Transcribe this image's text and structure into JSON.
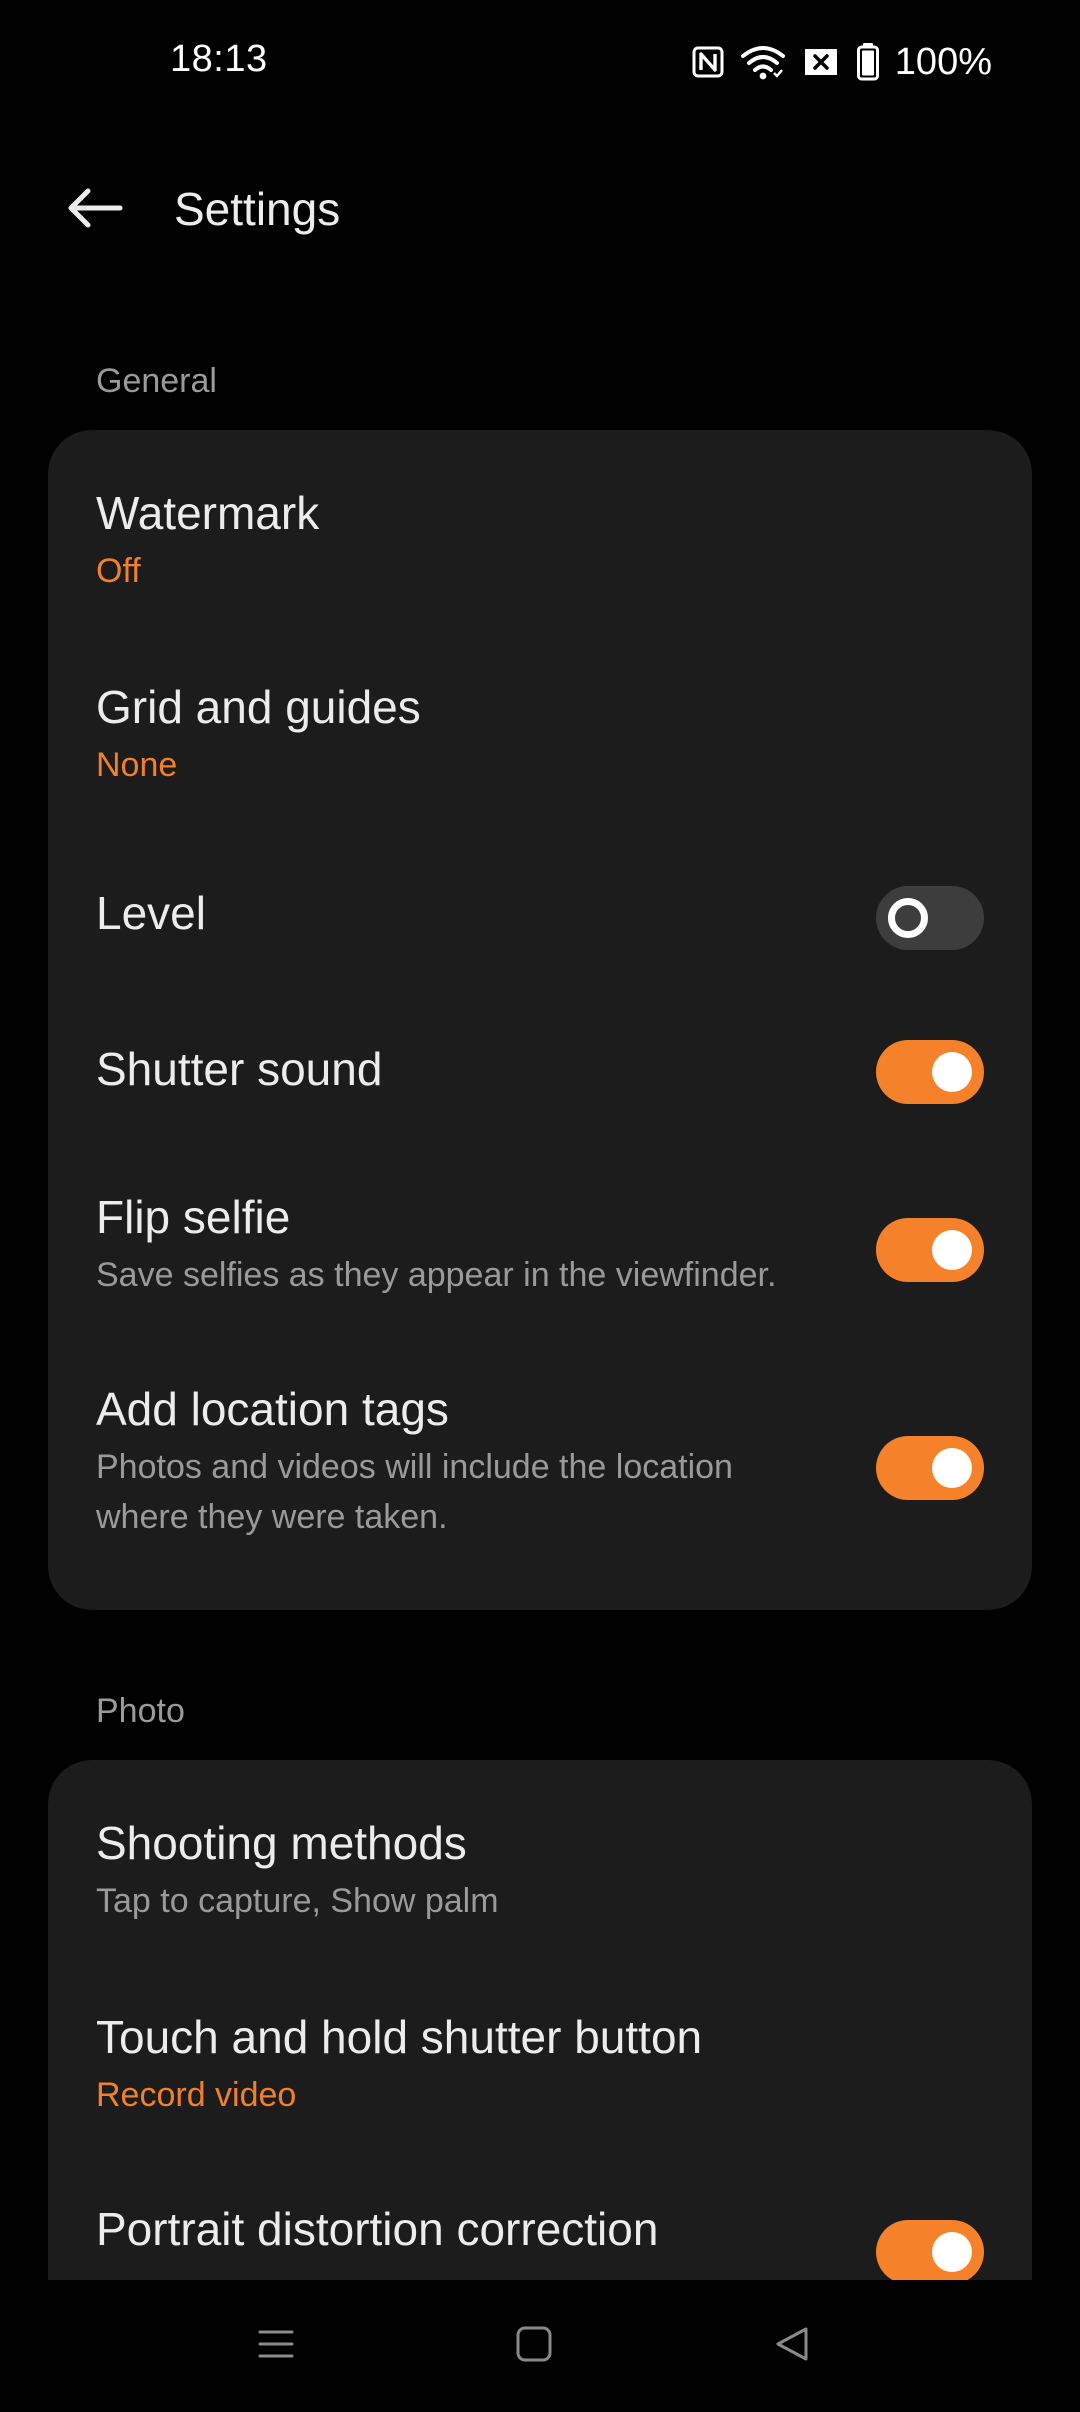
{
  "status_bar": {
    "time": "18:13",
    "battery": "100%",
    "icons": [
      "nfc-icon",
      "wifi-icon",
      "sim-off-icon",
      "battery-icon"
    ]
  },
  "header": {
    "title": "Settings",
    "back_icon": "arrow-left-icon"
  },
  "colors": {
    "accent": "#f5822a",
    "background": "#000000",
    "card": "#1c1c1c",
    "toggle_off": "#3d3d3d"
  },
  "sections": {
    "general": {
      "label": "General",
      "items": {
        "watermark": {
          "title": "Watermark",
          "value": "Off"
        },
        "grid": {
          "title": "Grid and guides",
          "value": "None"
        },
        "level": {
          "title": "Level",
          "enabled": false
        },
        "shutter_sound": {
          "title": "Shutter sound",
          "enabled": true
        },
        "flip_selfie": {
          "title": "Flip selfie",
          "description": "Save selfies as they appear in the viewfinder.",
          "enabled": true
        },
        "location_tags": {
          "title": "Add location tags",
          "description_line1": "Photos and videos will include the location",
          "description_line2": "where they were taken.",
          "enabled": true
        }
      }
    },
    "photo": {
      "label": "Photo",
      "items": {
        "shooting_methods": {
          "title": "Shooting methods",
          "value": "Tap to capture, Show palm"
        },
        "touch_hold": {
          "title": "Touch and hold shutter button",
          "value": "Record video"
        },
        "portrait_distortion": {
          "title": "Portrait distortion correction",
          "enabled": true
        }
      }
    }
  },
  "nav_bar": {
    "icons": [
      "menu-icon",
      "home-square-icon",
      "back-triangle-icon"
    ]
  }
}
